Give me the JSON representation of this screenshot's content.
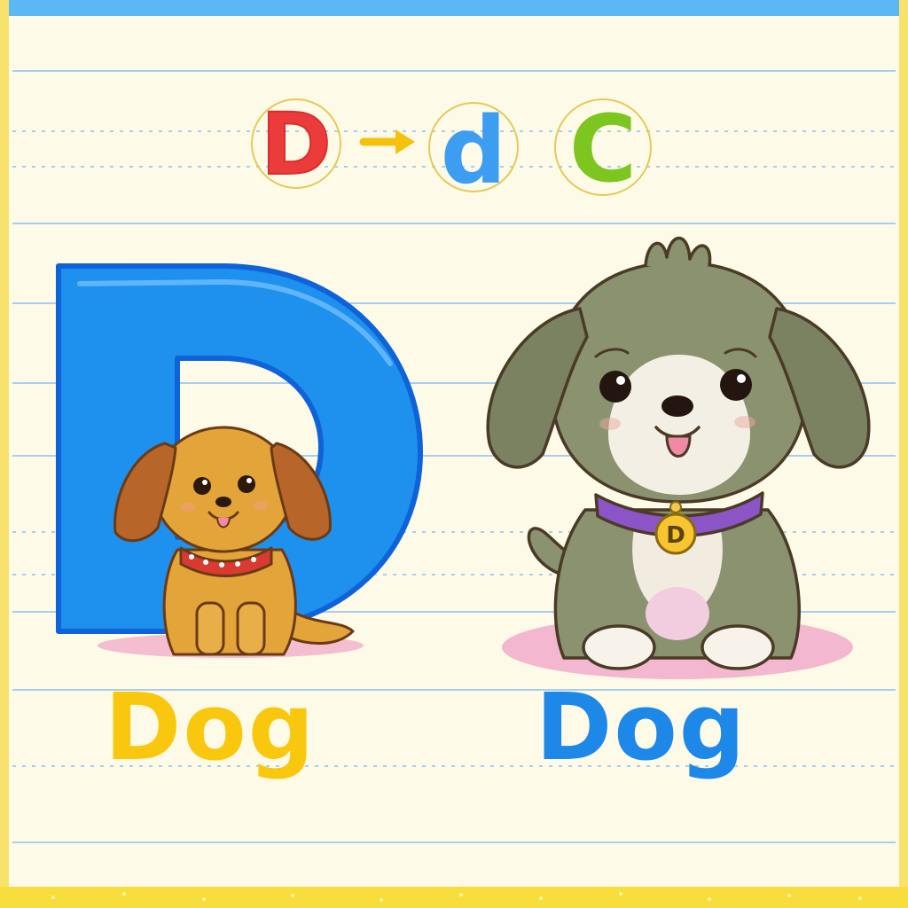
{
  "header_letters": [
    {
      "char": "D",
      "color": "#ec3b3b"
    },
    {
      "char": "d",
      "color": "#3d9df0"
    },
    {
      "char": "C",
      "color": "#7dc51f"
    }
  ],
  "arrow_color": "#f4c20d",
  "big_letter": {
    "char": "D",
    "color": "#1e90ee"
  },
  "words": [
    {
      "text": "Dog",
      "color": "#f9c80e"
    },
    {
      "text": "Dog",
      "color": "#1e88e8"
    }
  ],
  "tag_letter": "D",
  "colors": {
    "paper": "#fdfbe8",
    "top_border": "#5bb8f5",
    "side_border": "#f7e36b",
    "bottom_border": "#f8de3c",
    "ruled_line": "#a9cdf0",
    "small_dog_fur": "#e3a43a",
    "small_dog_ear": "#b8652a",
    "big_dog_fur": "#8a9270",
    "big_dog_collar": "#8b55c8",
    "small_dog_collar": "#d93a32",
    "shadow": "#f0a8c8"
  },
  "icons": [
    "arrow-right-icon",
    "dog-tag-icon",
    "paw-icon"
  ]
}
